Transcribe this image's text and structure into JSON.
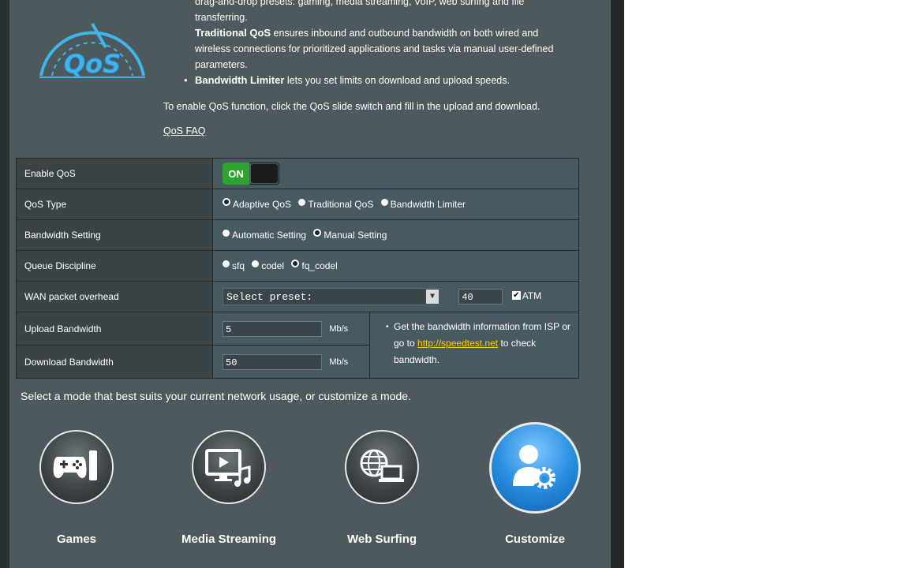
{
  "intro": {
    "line_cont_1": "drag-and-drop presets: gaming, media streaming, VoIP, web surfing and file",
    "line_cont_2": "transferring.",
    "bullets": [
      {
        "title": "Traditional QoS",
        "text_1": " ensures inbound and outbound bandwidth on both wired and",
        "text_2": "wireless connections for prioritized applications and tasks via manual user-defined",
        "text_3": "parameters."
      },
      {
        "title": "Bandwidth Limiter",
        "text_1": " lets you set limits on download and upload speeds."
      }
    ],
    "enable_text": "To enable QoS function, click the QoS slide switch and fill in the upload and download.",
    "faq": "QoS FAQ"
  },
  "settings": {
    "enable_qos": {
      "label": "Enable QoS",
      "state": "ON"
    },
    "qos_type": {
      "label": "QoS Type",
      "options": [
        "Adaptive QoS",
        "Traditional QoS",
        "Bandwidth Limiter"
      ],
      "selected": "Adaptive QoS"
    },
    "bandwidth_setting": {
      "label": "Bandwidth Setting",
      "options": [
        "Automatic Setting",
        "Manual Setting"
      ],
      "selected": "Manual Setting"
    },
    "queue_discipline": {
      "label": "Queue Discipline",
      "options": [
        "sfq",
        "codel",
        "fq_codel"
      ],
      "selected": "fq_codel"
    },
    "wan_overhead": {
      "label": "WAN packet overhead",
      "select_value": "Select preset:",
      "overhead_value": "40",
      "atm_label": "ATM",
      "atm_checked": true
    },
    "upload": {
      "label": "Upload Bandwidth",
      "value": "5",
      "unit": "Mb/s"
    },
    "download": {
      "label": "Download Bandwidth",
      "value": "50",
      "unit": "Mb/s"
    },
    "hint": {
      "text_1": "Get the bandwidth information from ISP or",
      "text_2": "go to ",
      "link": "http://speedtest.net",
      "text_3": " to check",
      "text_4": "bandwidth."
    }
  },
  "modes": {
    "prompt": "Select a mode that best suits your current network usage, or customize a mode.",
    "items": [
      {
        "label": "Games",
        "icon": "gamepad-icon"
      },
      {
        "label": "Media Streaming",
        "icon": "media-icon"
      },
      {
        "label": "Web Surfing",
        "icon": "web-icon"
      },
      {
        "label": "Customize",
        "icon": "customize-icon",
        "active": true
      }
    ]
  },
  "colors": {
    "panel": "#4d595d",
    "on_green": "#2fa32f",
    "link": "#ffcc00",
    "active_blue": "#2a8fe0"
  }
}
